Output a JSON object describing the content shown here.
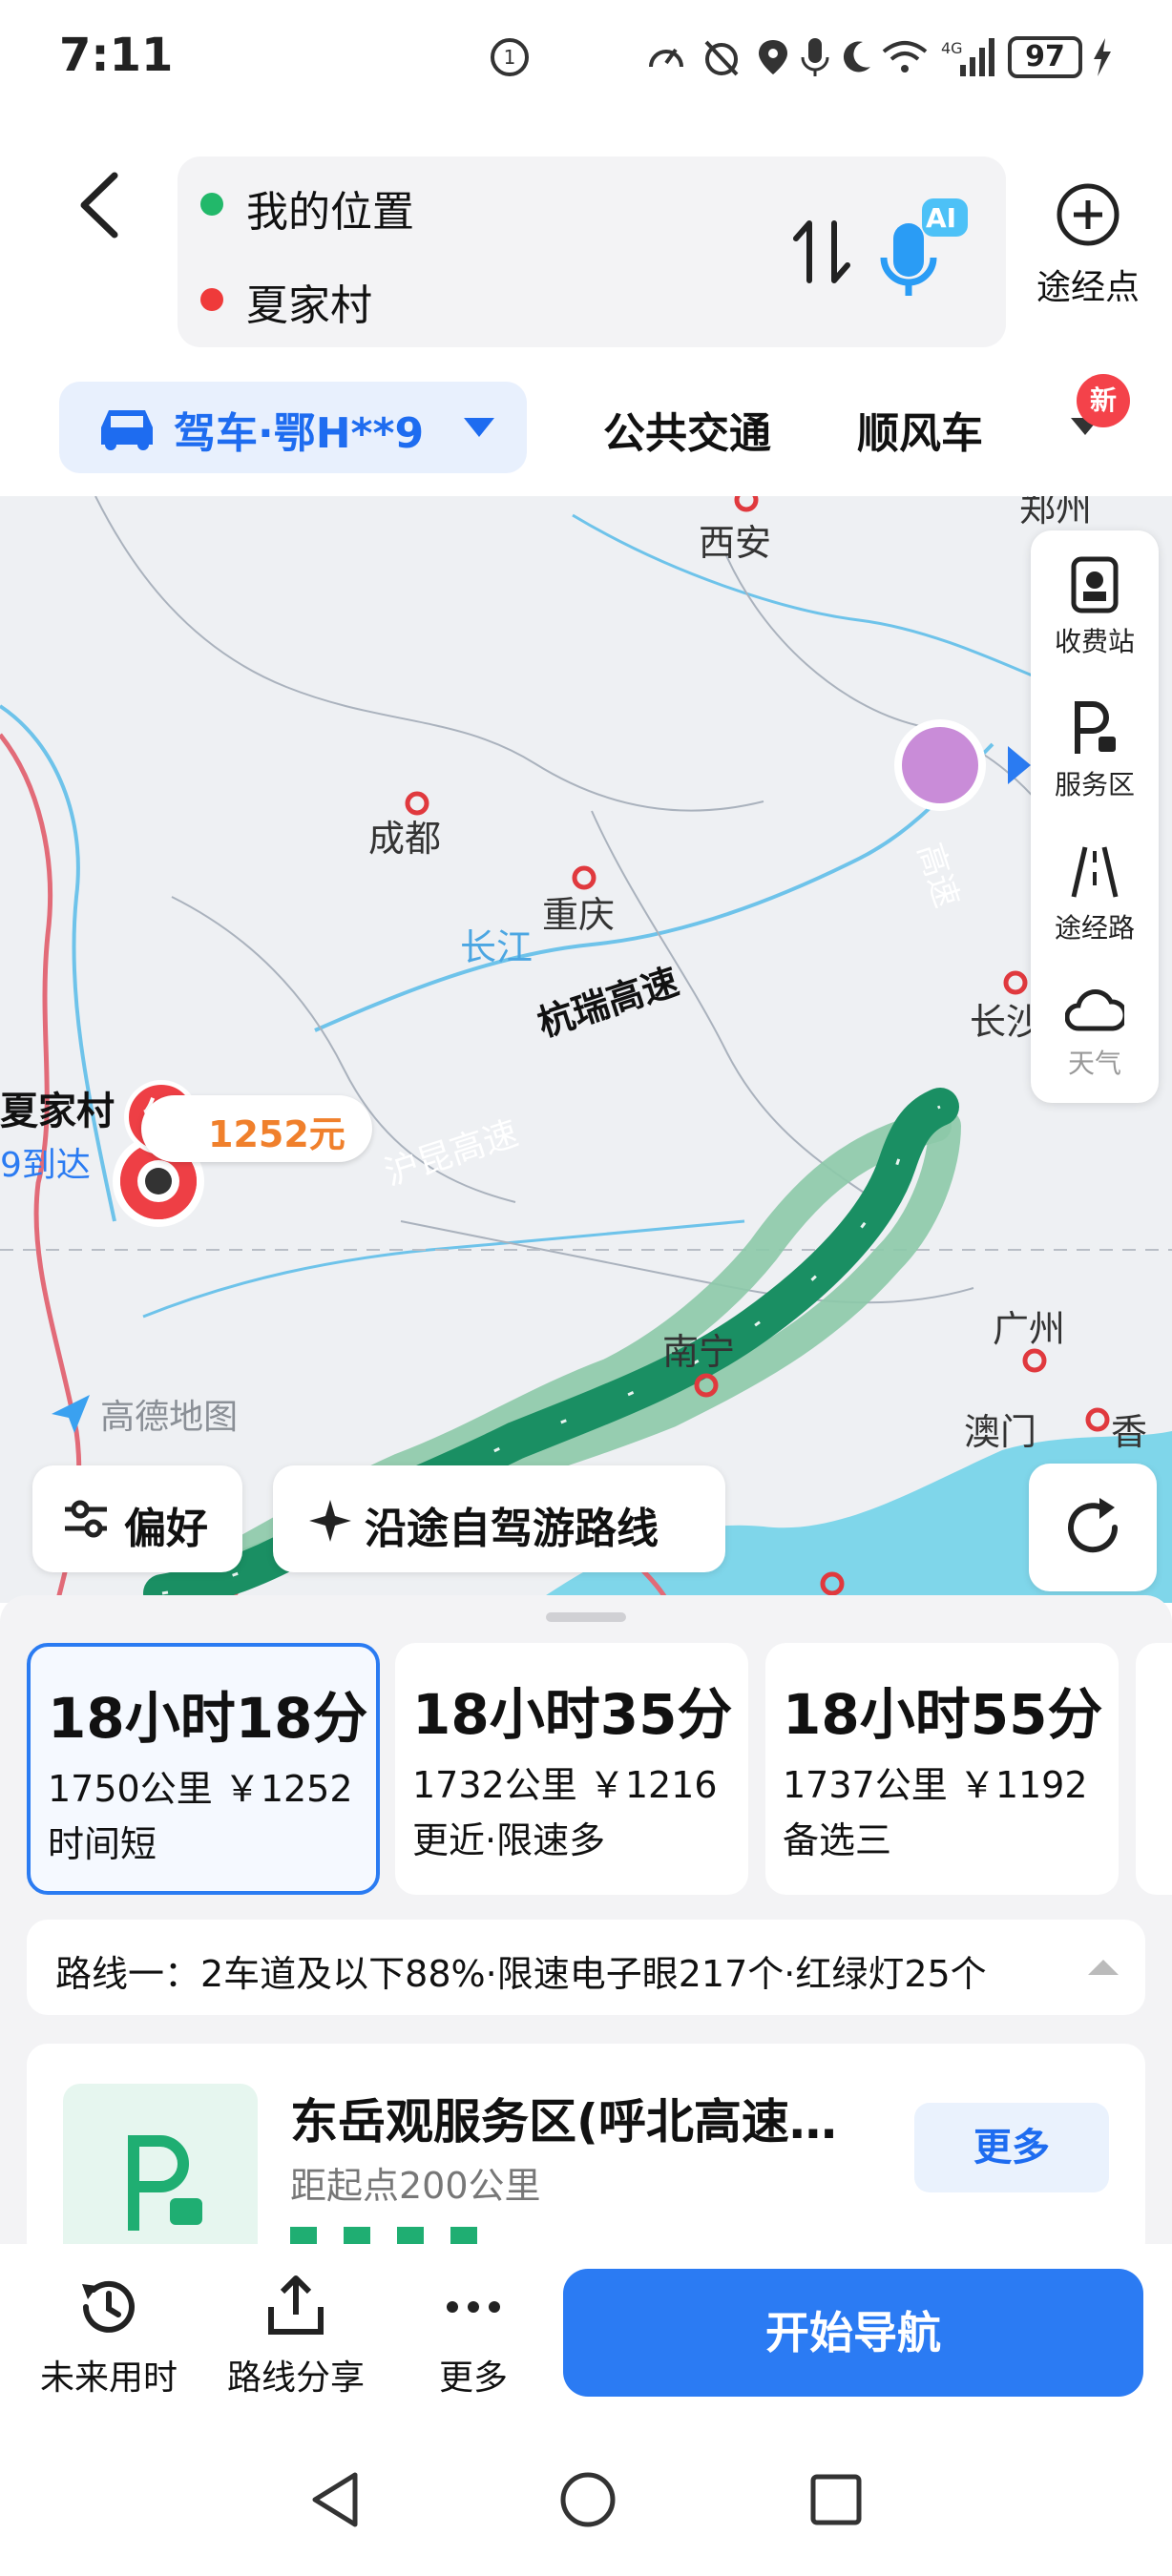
{
  "status_bar": {
    "time": "7:11",
    "battery": "97"
  },
  "header": {
    "origin": "我的位置",
    "destination": "夏家村",
    "waypoint_label": "途经点",
    "ai_label": "AI"
  },
  "modes": {
    "drive": "驾车·鄂H**9",
    "transit": "公共交通",
    "carpool": "顺风车",
    "new_badge": "新"
  },
  "map": {
    "cities": {
      "xian": "西安",
      "zhengzhou": "郑州",
      "chengdu": "成都",
      "chongqing": "重庆",
      "changjiang": "长江",
      "changsha": "长沙",
      "nanning": "南宁",
      "guangzhou": "广州",
      "macau": "澳门",
      "hongkong": "香港"
    },
    "roads": {
      "hangrui": "杭瑞高速",
      "hukun": "沪昆高速",
      "gaosu": "高速"
    },
    "destination_label": "夏家村",
    "arrive_label": "9到达",
    "end_marker": "终",
    "cost": "1252元",
    "map_brand": "高德地图",
    "side_panel": [
      "收费站",
      "服务区",
      "途经路",
      "天气"
    ],
    "preference_button": "偏好",
    "roadtrip_button": "沿途自驾游路线"
  },
  "routes": [
    {
      "time": "18小时18分",
      "distance": "1750公里",
      "cost": "￥1252",
      "note": "时间短",
      "selected": true
    },
    {
      "time": "18小时35分",
      "distance": "1732公里",
      "cost": "￥1216",
      "note": "更近·限速多",
      "selected": false
    },
    {
      "time": "18小时55分",
      "distance": "1737公里",
      "cost": "￥1192",
      "note": "备选三",
      "selected": false
    }
  ],
  "route_info": "路线一：2车道及以下88%·限速电子眼217个·红绿灯25个",
  "service_area": {
    "name": "东岳观服务区(呼北高速…",
    "distance": "距起点200公里",
    "more": "更多"
  },
  "bottom_bar": {
    "future_time": "未来用时",
    "share": "路线分享",
    "more": "更多",
    "start_nav": "开始导航"
  },
  "colors": {
    "accent": "#2b7bf3",
    "route_main": "#1a8f63",
    "route_alt": "#8cc9a8"
  }
}
